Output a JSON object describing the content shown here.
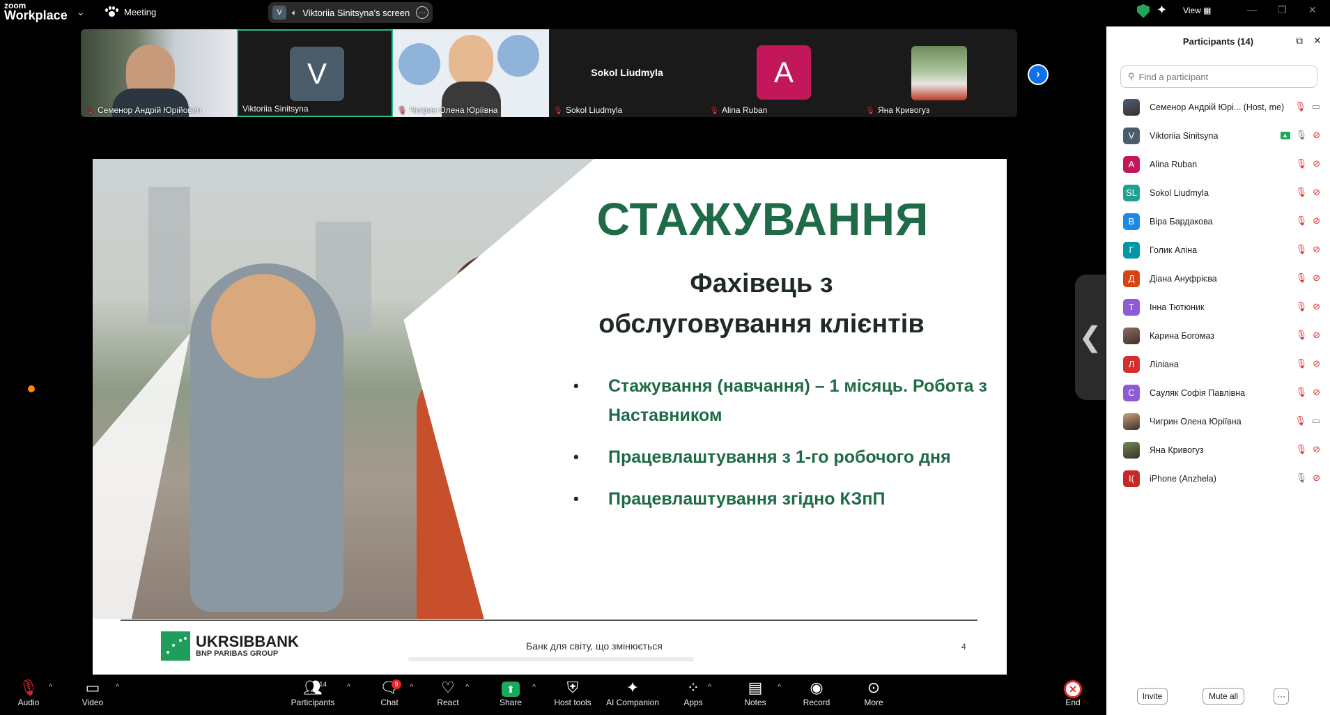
{
  "app": {
    "brand_line1": "zoom",
    "brand_line2": "Workplace",
    "meeting_label": "Meeting",
    "view_label": "View"
  },
  "screen_share": {
    "badge": "V",
    "label": "Viktoriia Sinitsyna's screen"
  },
  "video_tiles": [
    {
      "name": "Семенор Андрій Юрійович",
      "type": "video",
      "muted": true
    },
    {
      "name": "Viktoriia Sinitsyna",
      "type": "letter",
      "letter": "V",
      "color": "#4a5b6a",
      "muted": false,
      "active": true
    },
    {
      "name": "Чигрин Олена Юріївна",
      "type": "video",
      "muted": true
    },
    {
      "name": "Sokol Liudmyla",
      "type": "name_only",
      "center_name": "Sokol Liudmyla",
      "muted": true
    },
    {
      "name": "Alina Ruban",
      "type": "letter",
      "letter": "A",
      "color": "#c2185b",
      "muted": true
    },
    {
      "name": "Яна Кривогуз",
      "type": "photo",
      "muted": true
    }
  ],
  "slide": {
    "title": "СТАЖУВАННЯ",
    "subtitle_line1": "Фахівець з",
    "subtitle_line2": "обслуговування клієнтів",
    "bullets": [
      "Стажування (навчання) – 1 місяць. Робота з Наставником",
      "Працевлаштування з 1-го робочого дня",
      "Працевлаштування згідно КЗпП"
    ],
    "logo_name": "UKRSIBBANK",
    "logo_sub": "BNP PARIBAS GROUP",
    "tagline": "Банк для світу, що змінюється",
    "page_number": "4"
  },
  "participants_panel": {
    "title": "Participants (14)",
    "search_placeholder": "Find a participant",
    "invite_label": "Invite",
    "mute_all_label": "Mute all",
    "more_label": "···",
    "participants": [
      {
        "name": "Семенор Андрій Юрі...  (Host, me)",
        "avatar": "photo",
        "letter": "",
        "color": "#4b5e7a",
        "mic": "off",
        "cam": "on"
      },
      {
        "name": "Viktoriia Sinitsyna",
        "avatar": "letter",
        "letter": "V",
        "color": "#4a5b6a",
        "mic": "on",
        "cam": "off",
        "sharing": true
      },
      {
        "name": "Alina Ruban",
        "avatar": "letter",
        "letter": "A",
        "color": "#c2185b",
        "mic": "off",
        "cam": "off"
      },
      {
        "name": "Sokol Liudmyla",
        "avatar": "letter",
        "letter": "SL",
        "color": "#20a18e",
        "mic": "off",
        "cam": "off"
      },
      {
        "name": "Віра Бардакова",
        "avatar": "letter",
        "letter": "В",
        "color": "#1e88e5",
        "mic": "off",
        "cam": "off"
      },
      {
        "name": "Голик Аліна",
        "avatar": "letter",
        "letter": "Г",
        "color": "#0097a7",
        "mic": "off",
        "cam": "off"
      },
      {
        "name": "Діана Ануфрієва",
        "avatar": "letter",
        "letter": "Д",
        "color": "#d84315",
        "mic": "off",
        "cam": "off"
      },
      {
        "name": "Інна Тютюник",
        "avatar": "letter",
        "letter": "Т",
        "color": "#8e5bd6",
        "mic": "off",
        "cam": "off"
      },
      {
        "name": "Карина Богомаз",
        "avatar": "photo",
        "letter": "",
        "color": "#8d6e63",
        "mic": "off",
        "cam": "off"
      },
      {
        "name": "Ліліана",
        "avatar": "letter",
        "letter": "Л",
        "color": "#d32f2f",
        "mic": "off",
        "cam": "off"
      },
      {
        "name": "Сауляк Софія Павлівна",
        "avatar": "letter",
        "letter": "С",
        "color": "#8e5bd6",
        "mic": "off",
        "cam": "off"
      },
      {
        "name": "Чигрин Олена Юріївна",
        "avatar": "photo",
        "letter": "",
        "color": "#c9a27e",
        "mic": "off",
        "cam": "on"
      },
      {
        "name": "Яна Кривогуз",
        "avatar": "photo",
        "letter": "",
        "color": "#6d8b5a",
        "mic": "off",
        "cam": "off"
      },
      {
        "name": "iPhone (Anzhela)",
        "avatar": "letter",
        "letter": "I(",
        "color": "#c62828",
        "mic": "on",
        "cam": "off"
      }
    ]
  },
  "toolbar": {
    "audio": "Audio",
    "video": "Video",
    "participants": "Participants",
    "participants_count": "14",
    "chat": "Chat",
    "chat_badge": "9",
    "react": "React",
    "share": "Share",
    "host_tools": "Host tools",
    "ai_companion": "AI Companion",
    "apps": "Apps",
    "notes": "Notes",
    "record": "Record",
    "more": "More",
    "end": "End"
  }
}
